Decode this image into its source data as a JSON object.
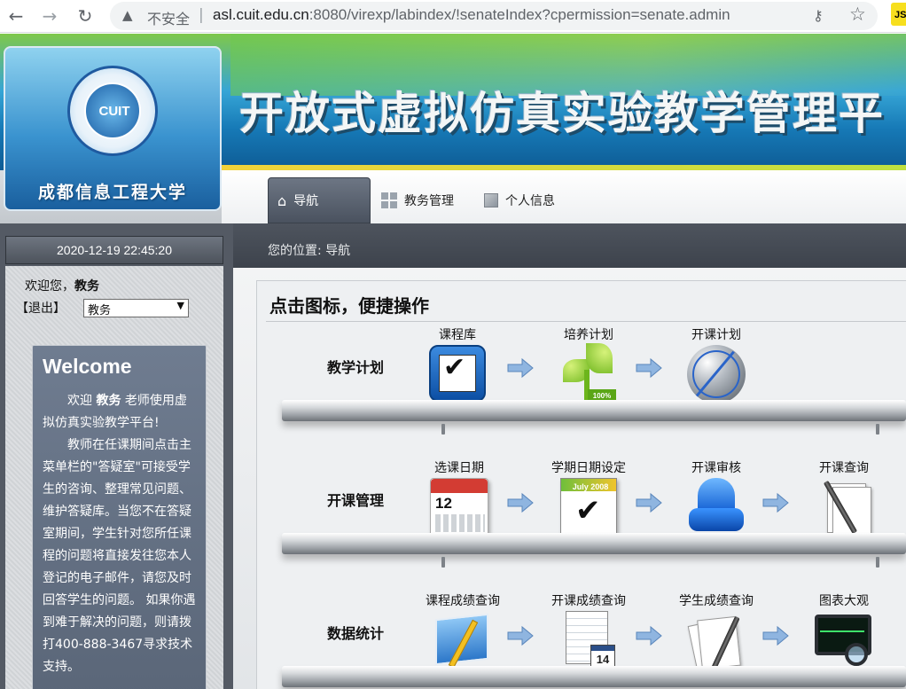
{
  "browser": {
    "security_label": "不安全",
    "url_host": "asl.cuit.edu.cn",
    "url_rest": ":8080/virexp/labindex/!senateIndex?cpermission=senate.admin",
    "extension_label": "JS",
    "icons": [
      "back-arrow-icon",
      "forward-arrow-icon",
      "reload-icon",
      "warning-triangle-icon",
      "key-icon",
      "star-icon"
    ]
  },
  "header": {
    "university_name": "成都信息工程大学",
    "logo_text": "CUIT",
    "site_title": "开放式虚拟仿真实验教学管理平"
  },
  "menu": {
    "tabs": [
      {
        "label": "导航",
        "icon": "home-icon"
      },
      {
        "label": "教务管理",
        "icon": "grid-icon"
      },
      {
        "label": "个人信息",
        "icon": "cube-icon"
      }
    ]
  },
  "status": {
    "datetime": "2020-12-19   22:45:20",
    "breadcrumb": "您的位置: 导航"
  },
  "user": {
    "greeting": "欢迎您，",
    "name": "教务",
    "logout_label": "【退出】",
    "role_selected": "教务"
  },
  "welcome": {
    "title": "Welcome",
    "para1_prefix": "欢迎 ",
    "para1_name": "教务",
    "para1_suffix": " 老师使用虚拟仿真实验教学平台!",
    "para2": "教师在任课期间点击主菜单栏的\"答疑室\"可接受学生的咨询、整理常见问题、维护答疑库。当您不在答疑室期间，学生针对您所任课程的问题将直接发往您本人登记的电子邮件，请您及时回答学生的问题。 如果你遇到难于解决的问题，则请拨打400-888-3467寻求技术支持。"
  },
  "panel": {
    "title": "点击图标，便捷操作",
    "rows": [
      {
        "label": "教学计划",
        "items": [
          "课程库",
          "培养计划",
          "开课计划"
        ]
      },
      {
        "label": "开课管理",
        "items": [
          "选课日期",
          "学期日期设定",
          "开课审核",
          "开课查询"
        ]
      },
      {
        "label": "数据统计",
        "items": [
          "课程成绩查询",
          "开课成绩查询",
          "学生成绩查询",
          "图表大观"
        ]
      }
    ],
    "calendar_day": "12",
    "calendar2_header": "July      2008",
    "sheet_day": "14",
    "plant_badge": "100%"
  },
  "colors": {
    "accent_blue": "#1679b6",
    "banner_green": "#7fc84a",
    "dark_bar": "#545a64"
  }
}
